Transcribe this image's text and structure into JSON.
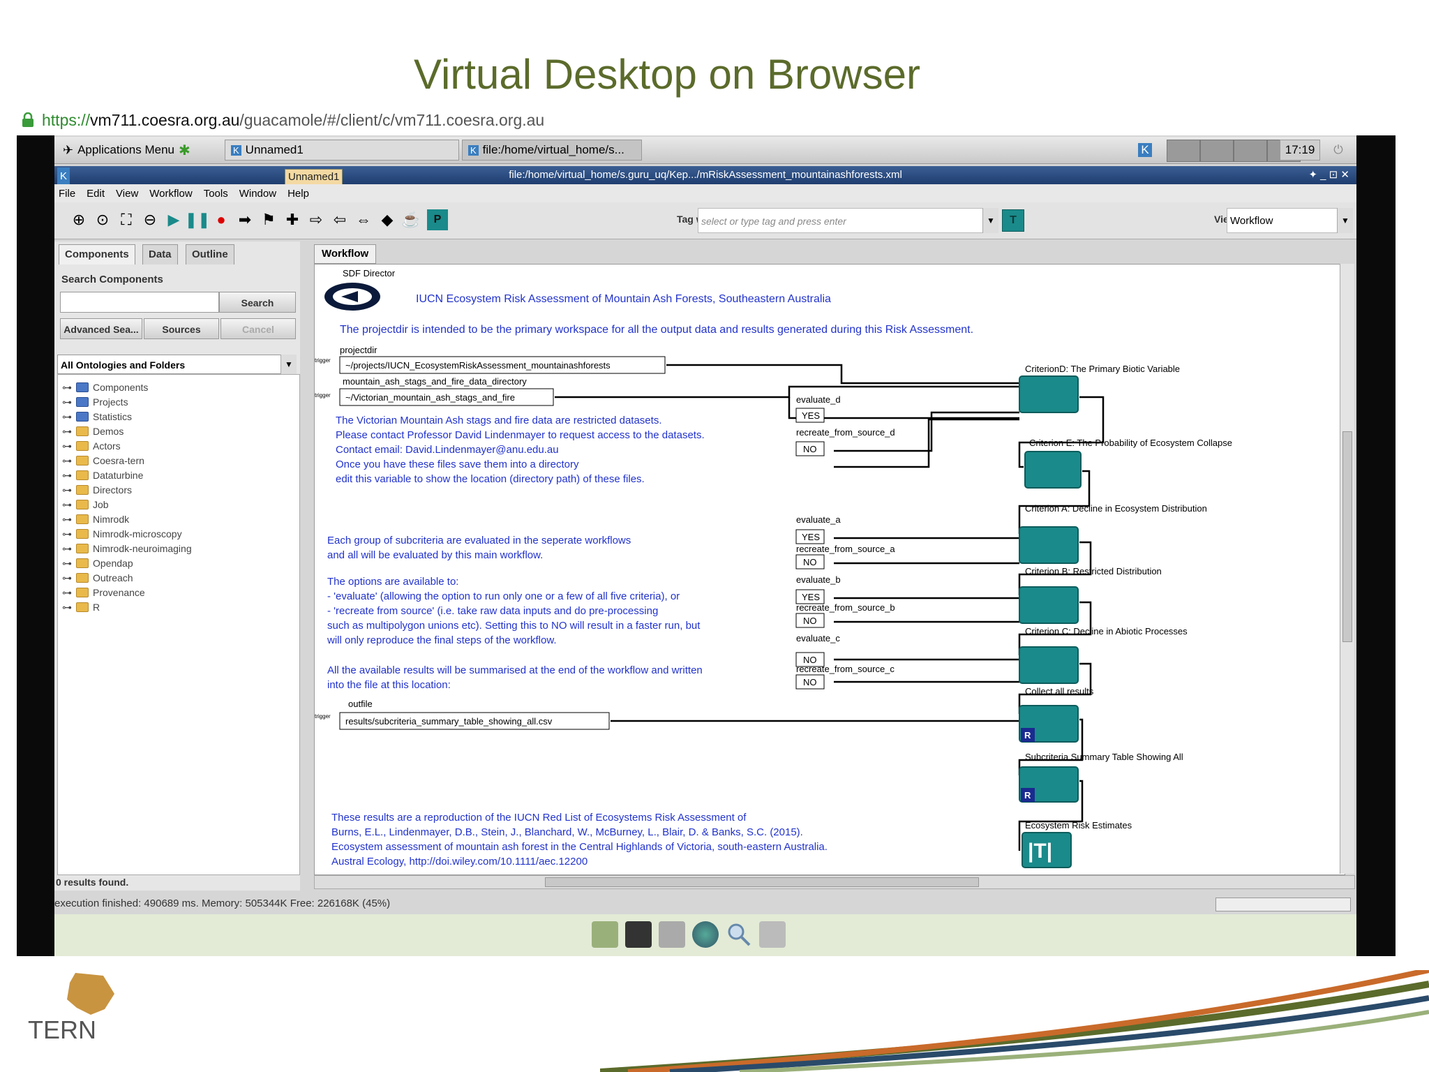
{
  "slide": {
    "title": "Virtual Desktop on Browser"
  },
  "browser": {
    "url_scheme": "https://",
    "url_host": "vm711.coesra.org.au",
    "url_path": "/guacamole/#/client/c/vm711.coesra.org.au"
  },
  "taskbar": {
    "apps_menu": "Applications Menu",
    "task1": "Unnamed1",
    "task2": "file:/home/virtual_home/s...",
    "clock": "17:19"
  },
  "window": {
    "title": "file:/home/virtual_home/s.guru_uq/Kep.../mRiskAssessment_mountainashforests.xml",
    "tooltip": "Unnamed1",
    "controls": "✦ _ ⊡ ✕"
  },
  "menu": [
    "File",
    "Edit",
    "View",
    "Workflow",
    "Tools",
    "Window",
    "Help"
  ],
  "toolbar": {
    "tag_label": "Tag workflow:",
    "tag_placeholder": "select or type tag and press enter",
    "view_label": "View:",
    "view_value": "Workflow",
    "tag_icon": "T",
    "p_icon": "P"
  },
  "left": {
    "tabs": [
      "Components",
      "Data",
      "Outline"
    ],
    "search_label": "Search Components",
    "search_btn": "Search",
    "adv_btn": "Advanced Sea...",
    "sources_btn": "Sources",
    "cancel_btn": "Cancel",
    "ontology": "All Ontologies and Folders",
    "results": "0 results found.",
    "tree": [
      "Components",
      "Projects",
      "Statistics",
      "Demos",
      "Actors",
      "Coesra-tern",
      "Dataturbine",
      "Directors",
      "Job",
      "Nimrodk",
      "Nimrodk-microscopy",
      "Nimrodk-neuroimaging",
      "Opendap",
      "Outreach",
      "Provenance",
      "R"
    ]
  },
  "canvas": {
    "tab": "Workflow",
    "director": "SDF Director",
    "heading": "IUCN Ecosystem Risk Assessment of Mountain Ash Forests, Southeastern Australia",
    "projectdir_note": "The projectdir is intended to be the primary workspace for all the output data and results generated during this Risk Assessment.",
    "projectdir_label": "projectdir",
    "projectdir_value": "~/projects/IUCN_EcosystemRiskAssessment_mountainashforests",
    "data_label": "mountain_ash_stags_and_fire_data_directory",
    "data_value": "~/Victorian_mountain_ash_stags_and_fire",
    "restricted": [
      "The Victorian Mountain Ash stags and fire data are restricted datasets.",
      "Please contact Professor David Lindenmayer to request access to the datasets.",
      "Contact email: David.Lindenmayer@anu.edu.au",
      "Once you have these files save them into a directory",
      "edit this variable to show the location (directory path) of these files."
    ],
    "groups": [
      "Each group of subcriteria are evaluated in the seperate workflows",
      "and all will be evaluated by this main workflow."
    ],
    "options": [
      "The options are available to:",
      "- 'evaluate' (allowing the option to run only one or a few of all five criteria), or",
      "- 'recreate from source' (i.e. take raw data inputs and do pre-processing",
      "  such as multipolygon unions etc). Setting this to NO will result in a faster run, but",
      "  will only reproduce the final steps of the workflow."
    ],
    "summary": [
      "All the available results will be summarised at the end of the workflow and written",
      "into the file at this location:"
    ],
    "outfile_label": "outfile",
    "outfile_value": "results/subcriteria_summary_table_showing_all.csv",
    "reference": [
      "These results are a reproduction of the IUCN Red List of Ecosystems Risk Assessment of",
      "Burns, E.L., Lindenmayer, D.B., Stein, J., Blanchard, W., McBurney, L., Blair, D. & Banks, S.C. (2015).",
      "Ecosystem assessment of mountain ash forest in the Central Highlands of Victoria, south-eastern Australia.",
      "Austral Ecology, http://doi.wiley.com/10.1111/aec.12200"
    ],
    "criteria": [
      "CriterionD: The Primary Biotic Variable",
      "Criterion E: The Probability of Ecosystem Collapse",
      "Criterion A: Decline in Ecosystem Distribution",
      "Criterion B: Restricted Distribution",
      "Criterion C: Decline in Abiotic Processes",
      "Collect all results",
      "Subcriteria Summary Table Showing All",
      "Ecosystem Risk Estimates"
    ],
    "params": {
      "evaluate_d": "evaluate_d",
      "recreate_d": "recreate_from_source_d",
      "evaluate_a": "evaluate_a",
      "recreate_a": "recreate_from_source_a",
      "evaluate_b": "evaluate_b",
      "recreate_b": "recreate_from_source_b",
      "evaluate_c": "evaluate_c",
      "recreate_c": "recreate_from_source_c",
      "yes": "YES",
      "no": "NO",
      "trigger": "trigger"
    },
    "r_badge": "R",
    "t_badge": "|T|"
  },
  "status": {
    "text": "execution finished: 490689 ms. Memory: 505344K Free: 226168K (45%)"
  },
  "logo": {
    "text": "TERN"
  },
  "colors": {
    "title": "#5b6b2b",
    "actor": "#1a8a8a",
    "note": "#2233cc"
  }
}
